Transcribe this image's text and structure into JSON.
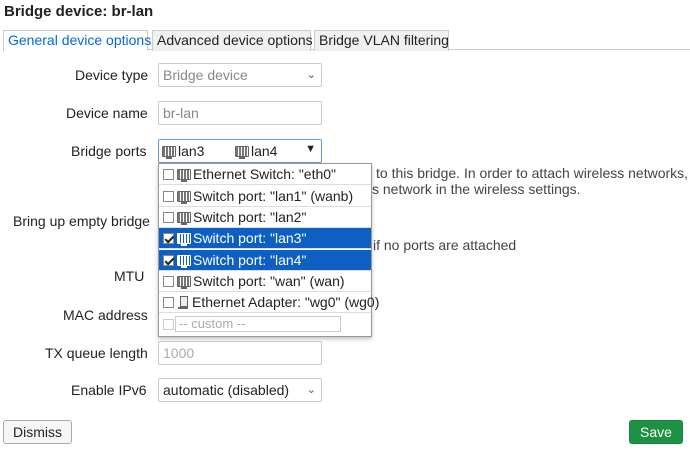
{
  "dialog": {
    "title": "Bridge device: br-lan"
  },
  "tabs": [
    {
      "label": "General device options",
      "active": true
    },
    {
      "label": "Advanced device options",
      "active": false
    },
    {
      "label": "Bridge VLAN filtering",
      "active": false
    }
  ],
  "form": {
    "device_type": {
      "label": "Device type",
      "value": "Bridge device"
    },
    "device_name": {
      "label": "Device name",
      "value": "br-lan"
    },
    "bridge_ports": {
      "label": "Bridge ports",
      "selected": [
        "lan3",
        "lan4"
      ],
      "description_line1": "to this bridge. In order to attach wireless networks,",
      "description_line2": "s network in the wireless settings.",
      "options": [
        {
          "label": "Ethernet Switch: \"eth0\"",
          "checked": false,
          "icon": "switch-port-icon"
        },
        {
          "label": "Switch port: \"lan1\" (wanb)",
          "checked": false,
          "icon": "switch-port-icon"
        },
        {
          "label": "Switch port: \"lan2\"",
          "checked": false,
          "icon": "switch-port-icon"
        },
        {
          "label": "Switch port: \"lan3\"",
          "checked": true,
          "icon": "switch-port-icon"
        },
        {
          "label": "Switch port: \"lan4\"",
          "checked": true,
          "icon": "switch-port-icon"
        },
        {
          "label": "Switch port: \"wan\" (wan)",
          "checked": false,
          "icon": "switch-port-icon"
        },
        {
          "label": "Ethernet Adapter: \"wg0\" (wg0)",
          "checked": false,
          "icon": "network-adapter-icon"
        }
      ],
      "custom_placeholder": "-- custom --"
    },
    "bring_up_empty_bridge": {
      "label": "Bring up empty bridge",
      "description": "if no ports are attached"
    },
    "mtu": {
      "label": "MTU"
    },
    "mac_address": {
      "label": "MAC address"
    },
    "tx_queue_length": {
      "label": "TX queue length",
      "placeholder": "1000"
    },
    "enable_ipv6": {
      "label": "Enable IPv6",
      "value": "automatic (disabled)"
    }
  },
  "buttons": {
    "dismiss": "Dismiss",
    "save": "Save"
  },
  "colors": {
    "accent": "#0069d6",
    "selected_row": "#0d5fc4",
    "save": "#1e9142"
  }
}
